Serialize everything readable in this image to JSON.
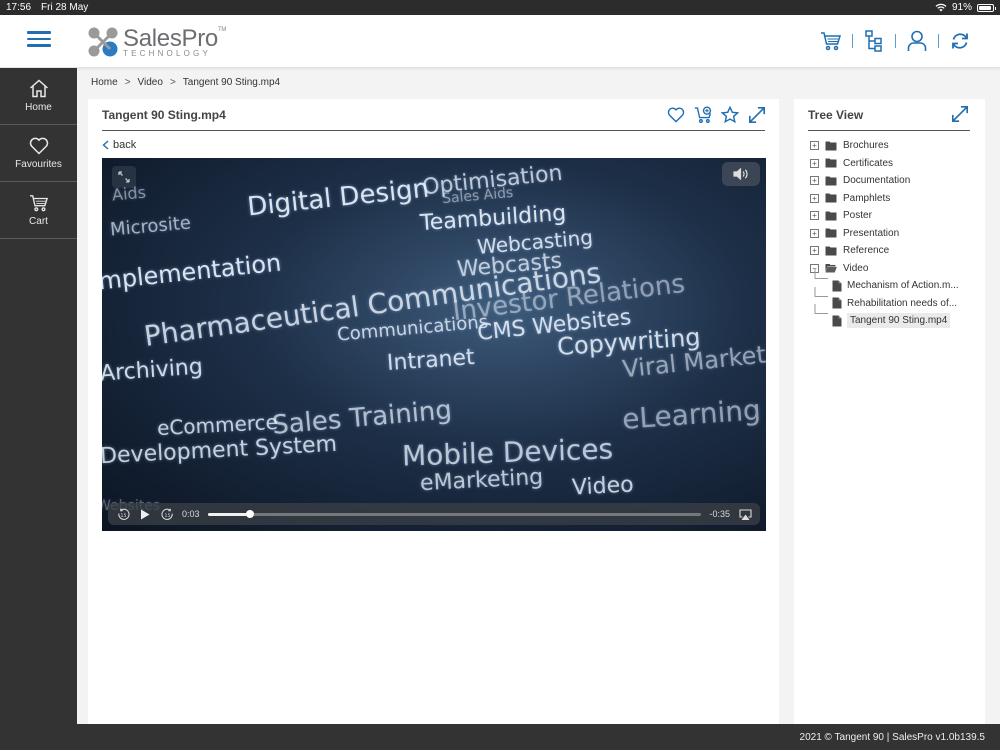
{
  "status_bar": {
    "time": "17:56",
    "date": "Fri 28 May",
    "battery": "91%",
    "battery_level": 0.91
  },
  "header": {
    "logo_name": "SalesPro",
    "logo_tm": "TM",
    "logo_sub": "TECHNOLOGY",
    "icons": [
      "cart-icon",
      "tree-view-icon",
      "user-icon",
      "sync-icon"
    ]
  },
  "sidebar": {
    "items": [
      {
        "label": "Home",
        "icon": "home-icon"
      },
      {
        "label": "Favourites",
        "icon": "heart-icon"
      },
      {
        "label": "Cart",
        "icon": "cart-icon"
      }
    ]
  },
  "breadcrumb": {
    "items": [
      "Home",
      "Video",
      "Tangent 90 Sting.mp4"
    ],
    "separator": ">"
  },
  "main": {
    "title": "Tangent 90 Sting.mp4",
    "back_label": "back",
    "actions": [
      "heart-icon",
      "add-to-cart-icon",
      "star-icon",
      "expand-icon"
    ]
  },
  "video": {
    "elapsed": "0:03",
    "remaining": "-0:35",
    "progress": 0.086,
    "frame_words": [
      "Digital Design",
      "Optimisation",
      "Sales Aids",
      "Teambuilding",
      "Webcasting",
      "Webcasts",
      "mplementation",
      "Pharmaceutical Communications",
      "Investor Relations",
      "Communications",
      "CMS Websites",
      "Copywriting",
      "Intranet",
      "Viral Marketing",
      "Archiving",
      "eCommerce",
      "Sales Training",
      "Development System",
      "Mobile Devices",
      "eMarketing",
      "eLearning",
      "Aids",
      "Microsite",
      "Websites",
      "Video"
    ]
  },
  "tree": {
    "title": "Tree View",
    "folders": [
      {
        "label": "Brochures",
        "expanded": false
      },
      {
        "label": "Certificates",
        "expanded": false
      },
      {
        "label": "Documentation",
        "expanded": false
      },
      {
        "label": "Pamphlets",
        "expanded": false
      },
      {
        "label": "Poster",
        "expanded": false
      },
      {
        "label": "Presentation",
        "expanded": false
      },
      {
        "label": "Reference",
        "expanded": false
      },
      {
        "label": "Video",
        "expanded": true
      }
    ],
    "video_children": [
      {
        "label": "Mechanism of Action.m..."
      },
      {
        "label": "Rehabilitation needs of..."
      },
      {
        "label": "Tangent 90 Sting.mp4",
        "selected": true
      }
    ]
  },
  "footer": {
    "text": "2021 © Tangent 90 | SalesPro v1.0b139.5"
  },
  "colors": {
    "accent": "#1f6fb2",
    "sidebar": "#333333",
    "footer": "#333333"
  }
}
